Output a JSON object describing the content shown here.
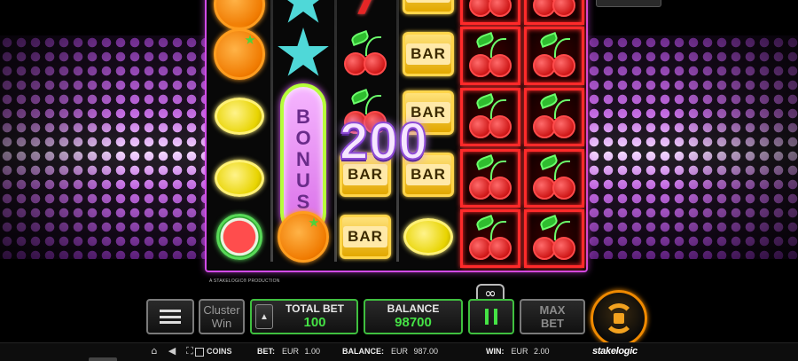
{
  "win": {
    "amount": "200"
  },
  "reels": {
    "reel1": [
      "orange",
      "orange",
      "lemon",
      "lemon",
      "watermelon"
    ],
    "reel2": [
      "star",
      "star",
      "bonus",
      "orange"
    ],
    "reel3": [
      "seven",
      "cherry",
      "cherry",
      "bar",
      "bar"
    ],
    "reel4": [
      "bar",
      "bar",
      "bar",
      "bar",
      "lemon"
    ],
    "reel5": [
      "cherry",
      "cherry",
      "cherry",
      "cherry",
      "cherry"
    ],
    "reel6": [
      "cherry",
      "cherry",
      "cherry",
      "cherry",
      "cherry"
    ],
    "bar_label": "BAR",
    "bonus_letters": [
      "B",
      "O",
      "N",
      "U",
      "S"
    ]
  },
  "production_text": "A STAKELOGIC® PRODUCTION",
  "infinity_label": "∞",
  "controls": {
    "cluster_label_1": "Cluster",
    "cluster_label_2": "Win",
    "total_bet_title": "TOTAL BET",
    "total_bet_value": "100",
    "balance_title": "BALANCE",
    "balance_value": "98700",
    "max_bet_1": "MAX",
    "max_bet_2": "BET"
  },
  "status_bar": {
    "coins_label": "COINS",
    "bet_label": "BET:",
    "bet_currency": "EUR",
    "bet_value": "1.00",
    "balance_label": "BALANCE:",
    "balance_currency": "EUR",
    "balance_value": "987.00",
    "win_label": "WIN:",
    "win_currency": "EUR",
    "win_value": "2.00",
    "brand": "stakelogic"
  },
  "colors": {
    "frame": "#d24be8",
    "accent_green": "#45e245",
    "spin_orange": "#f08a00",
    "cherry_border": "#ff2a2a"
  },
  "icons": [
    "home-icon",
    "sound-icon",
    "fullscreen-icon",
    "coins-toggle-icon",
    "menu-icon",
    "bet-up-icon",
    "pause-icon",
    "spin-icon",
    "infinity-icon"
  ]
}
